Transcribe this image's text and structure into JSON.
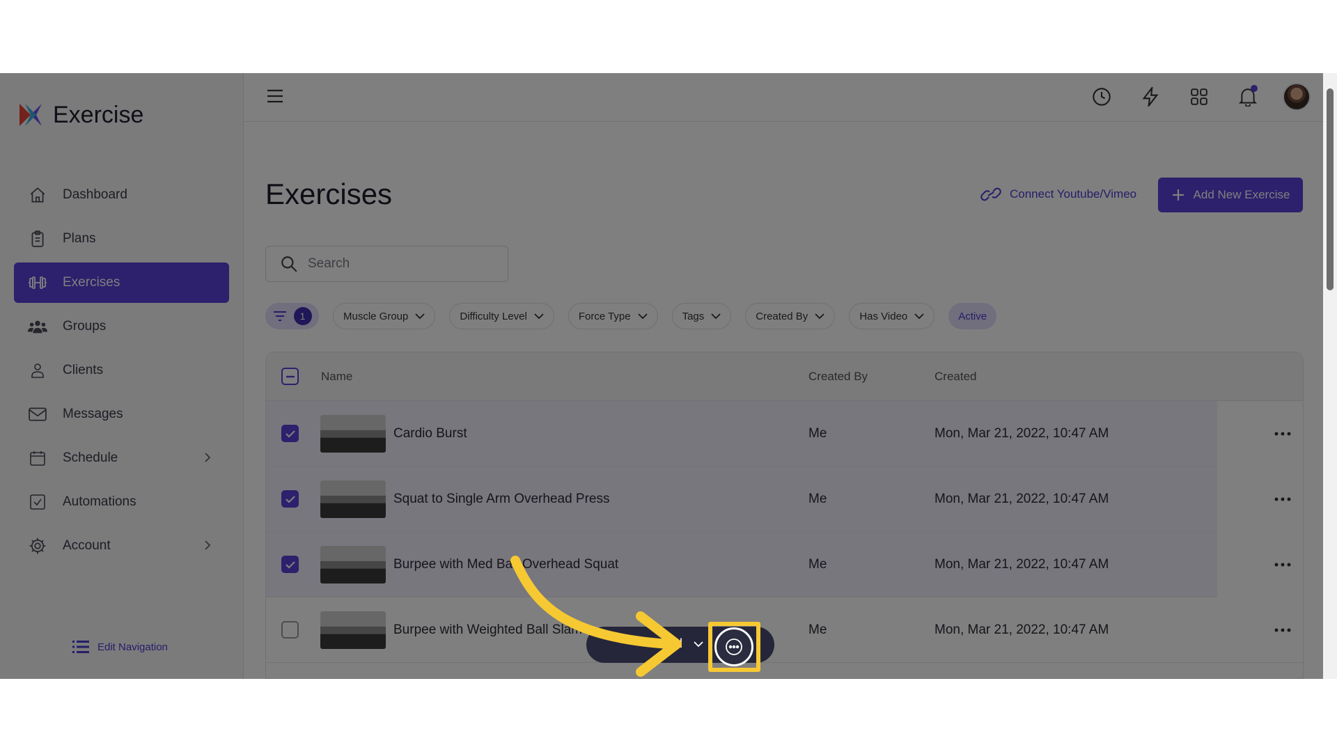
{
  "app": {
    "title": "Exercise"
  },
  "sidebar": {
    "items": [
      {
        "label": "Dashboard",
        "icon": "home-icon"
      },
      {
        "label": "Plans",
        "icon": "clipboard-icon"
      },
      {
        "label": "Exercises",
        "icon": "dumbbell-icon",
        "active": true
      },
      {
        "label": "Groups",
        "icon": "users-icon"
      },
      {
        "label": "Clients",
        "icon": "user-icon"
      },
      {
        "label": "Messages",
        "icon": "mail-icon"
      },
      {
        "label": "Schedule",
        "icon": "calendar-icon",
        "has_submenu": true
      },
      {
        "label": "Automations",
        "icon": "checkbox-icon"
      },
      {
        "label": "Account",
        "icon": "gear-icon",
        "has_submenu": true
      }
    ],
    "edit_navigation": "Edit Navigation"
  },
  "page": {
    "title": "Exercises",
    "connect_label": "Connect Youtube/Vimeo",
    "add_label": "Add New Exercise"
  },
  "search": {
    "placeholder": "Search",
    "value": ""
  },
  "filters": {
    "active_count": "1",
    "chips": [
      "Muscle Group",
      "Difficulty Level",
      "Force Type",
      "Tags",
      "Created By",
      "Has Video"
    ],
    "status_chip": "Active"
  },
  "table": {
    "headers": {
      "name": "Name",
      "created_by": "Created By",
      "created": "Created"
    },
    "rows": [
      {
        "name": "Cardio Burst",
        "created_by": "Me",
        "created": "Mon, Mar 21, 2022, 10:47 AM",
        "checked": true
      },
      {
        "name": "Squat to Single Arm Overhead Press",
        "created_by": "Me",
        "created": "Mon, Mar 21, 2022, 10:47 AM",
        "checked": true
      },
      {
        "name": "Burpee with Med Ball Overhead Squat",
        "created_by": "Me",
        "created": "Mon, Mar 21, 2022, 10:47 AM",
        "checked": true
      },
      {
        "name": "Burpee with Weighted Ball Slam",
        "created_by": "Me",
        "created": "Mon, Mar 21, 2022, 10:47 AM",
        "checked": false
      }
    ]
  },
  "bulk_bar": {
    "label": "ed"
  },
  "colors": {
    "accent": "#5a41d9",
    "highlight": "#f6c933",
    "arrow": "#f6c933"
  }
}
